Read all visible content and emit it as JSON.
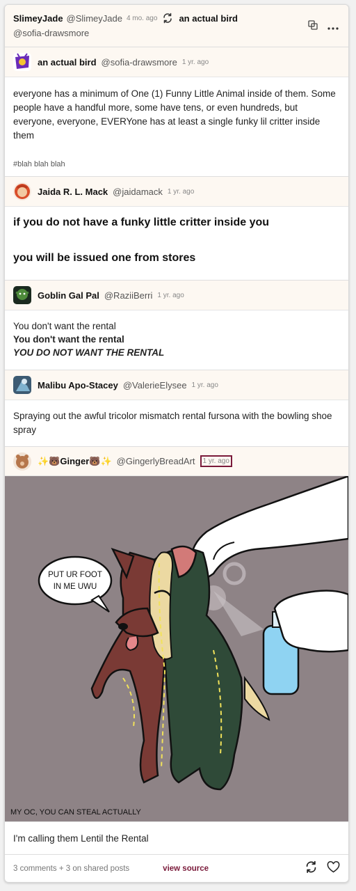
{
  "header": {
    "reblogger_name": "SlimeyJade",
    "reblogger_handle": "@SlimeyJade",
    "reblogger_time": "4 mo. ago",
    "reblogged_from_name": "an actual bird",
    "reblogged_from_handle": "@sofia-drawsmore",
    "icons": [
      "reblog-icon",
      "copy-icon",
      "more-menu-icon"
    ]
  },
  "posts": [
    {
      "name": "an actual bird",
      "handle": "@sofia-drawsmore",
      "time": "1 yr. ago",
      "text": "everyone has a minimum of One (1) Funny Little Animal inside of them. Some people have a handful more, some have tens, or even hundreds, but everyone, everyone, EVERYone has at least a single funky lil critter inside them",
      "tag": "#blah blah blah"
    },
    {
      "name": "Jaida R. L. Mack",
      "handle": "@jaidamack",
      "time": "1 yr. ago",
      "line1": "if you do not have a funky little critter inside you",
      "line2": "you will be issued one from stores"
    },
    {
      "name": "Goblin Gal Pal",
      "handle": "@RaziiBerri",
      "time": "1 yr. ago",
      "line1": "You don't want the rental",
      "line2": "You don't want the rental",
      "line3": "YOU DO NOT WANT THE RENTAL"
    },
    {
      "name": "Malibu Apo-Stacey",
      "handle": "@ValerieElysee",
      "time": "1 yr. ago",
      "text": "Spraying out the awful tricolor mismatch rental fursona with the bowling shoe spray"
    },
    {
      "name": "✨🐻Ginger🐻✨",
      "handle": "@GingerlyBreadArt",
      "time": "1 yr. ago",
      "speech_bubble": [
        "PUT UR FOOT",
        "IN ME UWU"
      ],
      "comic_caption": "MY OC, YOU CAN STEAL ACTUALLY",
      "text": "I'm calling them Lentil the Rental"
    }
  ],
  "footer": {
    "notes": "3 comments + 3 on shared posts",
    "view_source": "view source",
    "icons": [
      "reblog-icon",
      "like-heart-icon"
    ]
  },
  "colors": {
    "header_bg": "#fdf8f2",
    "accent": "#7a1a3a",
    "comic_bg": "#8e8386"
  }
}
